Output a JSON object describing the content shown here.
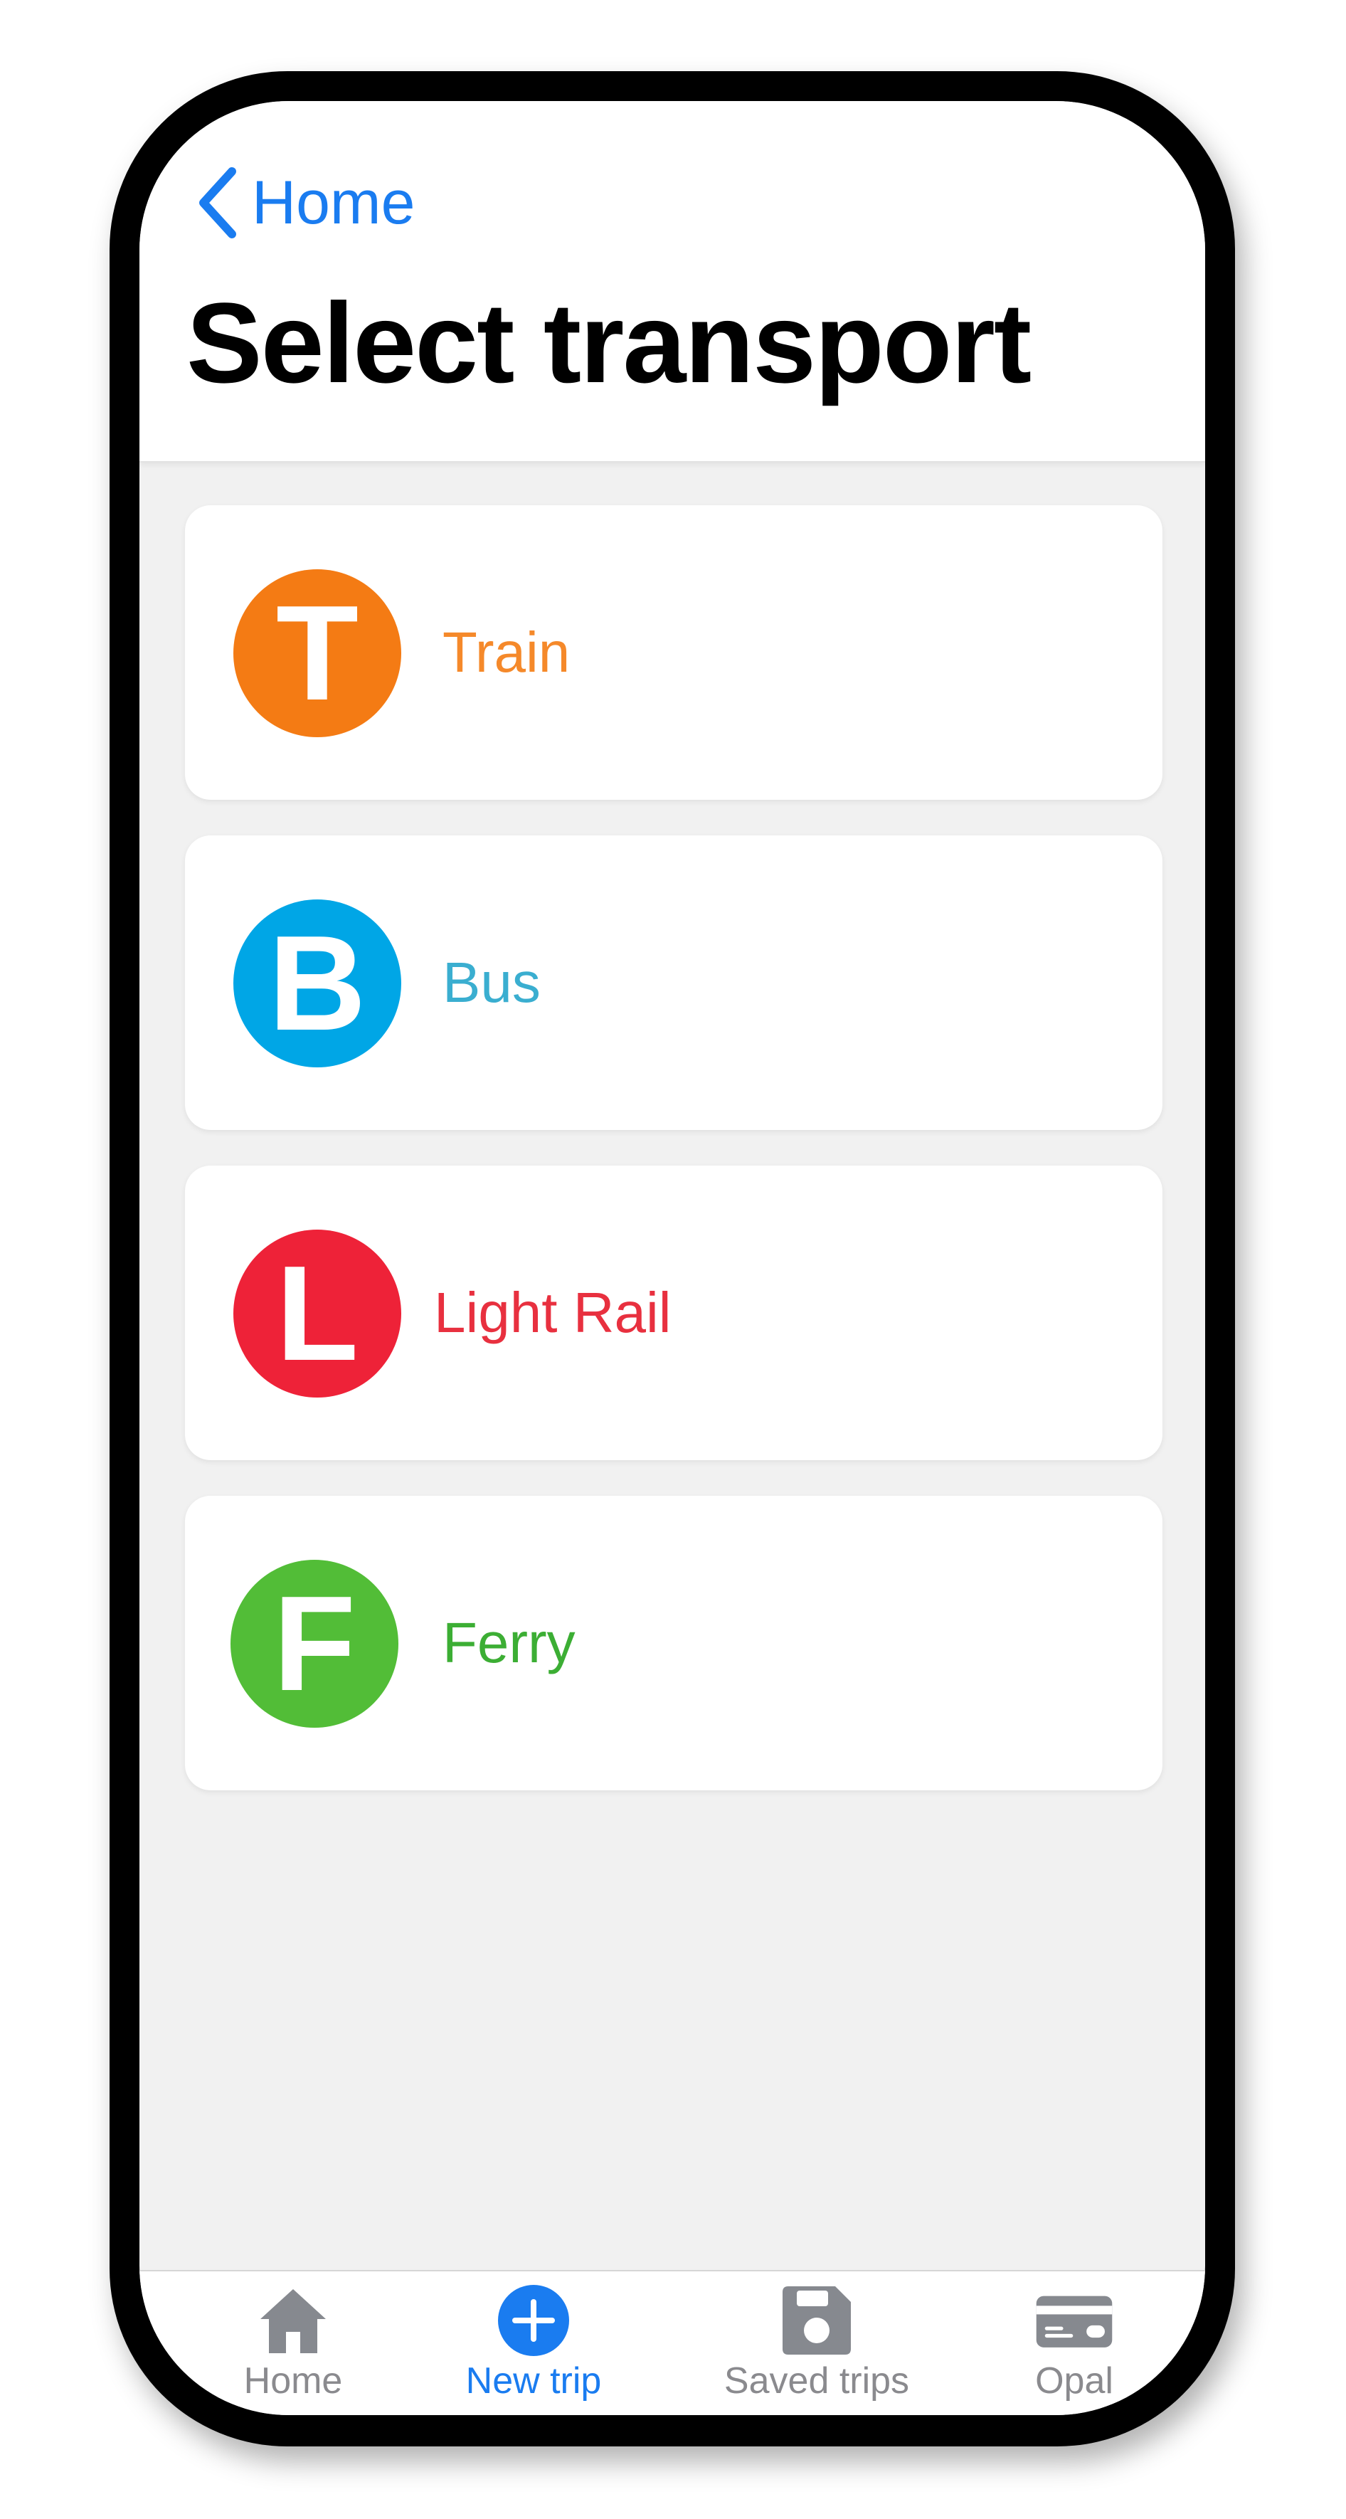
{
  "header": {
    "back_label": "Home",
    "title": "Select transport"
  },
  "transport_modes": [
    {
      "letter": "T",
      "label": "Train",
      "badge_color": "#f47b14",
      "label_color": "#f5892a",
      "icon": "train-icon"
    },
    {
      "letter": "B",
      "label": "Bus",
      "badge_color": "#00a6e6",
      "label_color": "#3aaed0",
      "icon": "bus-icon"
    },
    {
      "letter": "L",
      "label": "Light Rail",
      "badge_color": "#ee2238",
      "label_color": "#e8303f",
      "icon": "light-rail-icon"
    },
    {
      "letter": "F",
      "label": "Ferry",
      "badge_color": "#52bd37",
      "label_color": "#3cae34",
      "icon": "ferry-icon"
    }
  ],
  "tabbar": {
    "tabs": [
      {
        "label": "Home",
        "icon": "home-icon",
        "active": false
      },
      {
        "label": "New trip",
        "icon": "plus-circle-icon",
        "active": true
      },
      {
        "label": "Saved trips",
        "icon": "save-icon",
        "active": false
      },
      {
        "label": "Opal",
        "icon": "card-icon",
        "active": false
      }
    ]
  },
  "colors": {
    "accent": "#1a7cf0",
    "tab_inactive": "#8a8a8e",
    "background": "#f1f1f1"
  }
}
